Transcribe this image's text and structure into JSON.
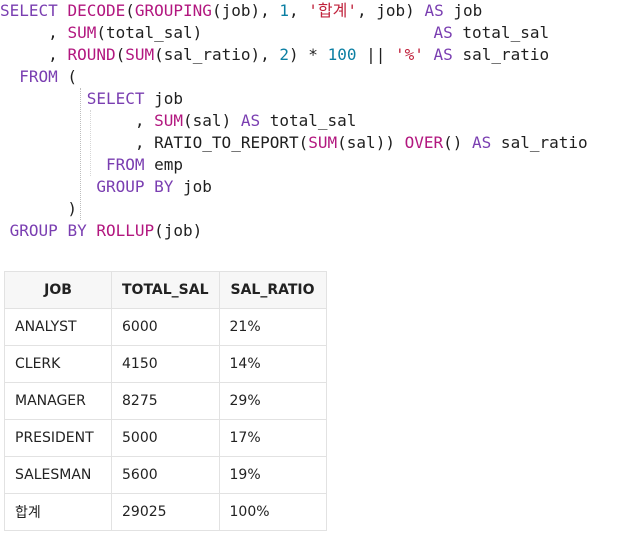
{
  "sql": {
    "line1": {
      "t0": "SELECT",
      "t1": " ",
      "t2": "DECODE",
      "t3": "(",
      "t4": "GROUPING",
      "t5": "(job), ",
      "t6": "1",
      "t7": ", ",
      "t8": "'합계'",
      "t9": ", job) ",
      "t10": "AS",
      "t11": " job"
    },
    "line2": {
      "t0": "     , ",
      "t1": "SUM",
      "t2": "(total_sal)",
      "t3": "                        ",
      "t4": "AS",
      "t5": " total_sal"
    },
    "line3": {
      "t0": "     , ",
      "t1": "ROUND",
      "t2": "(",
      "t3": "SUM",
      "t4": "(sal_ratio), ",
      "t5": "2",
      "t6": ") * ",
      "t7": "100",
      "t8": " || ",
      "t9": "'%'",
      "t10": " ",
      "t11": "AS",
      "t12": " sal_ratio"
    },
    "line4": {
      "t0": "  ",
      "t1": "FROM",
      "t2": " ("
    },
    "line5": {
      "t0": "         ",
      "t1": "SELECT",
      "t2": " job"
    },
    "line6": {
      "t0": "              , ",
      "t1": "SUM",
      "t2": "(sal) ",
      "t3": "AS",
      "t4": " total_sal"
    },
    "line7": {
      "t0": "              , RATIO_TO_REPORT(",
      "t1": "SUM",
      "t2": "(sal)) ",
      "t3": "OVER",
      "t4": "() ",
      "t5": "AS",
      "t6": " sal_ratio"
    },
    "line8": {
      "t0": "           ",
      "t1": "FROM",
      "t2": " emp"
    },
    "line9": {
      "t0": "          ",
      "t1": "GROUP BY",
      "t2": " job"
    },
    "line10": {
      "t0": "       )"
    },
    "line11": {
      "t0": " ",
      "t1": "GROUP BY",
      "t2": " ",
      "t3": "ROLLUP",
      "t4": "(job)"
    }
  },
  "result": {
    "headers": [
      "JOB",
      "TOTAL_SAL",
      "SAL_RATIO"
    ],
    "rows": [
      [
        "ANALYST",
        "6000",
        "21%"
      ],
      [
        "CLERK",
        "4150",
        "14%"
      ],
      [
        "MANAGER",
        "8275",
        "29%"
      ],
      [
        "PRESIDENT",
        "5000",
        "17%"
      ],
      [
        "SALESMAN",
        "5600",
        "19%"
      ],
      [
        "합계",
        "29025",
        "100%"
      ]
    ]
  }
}
